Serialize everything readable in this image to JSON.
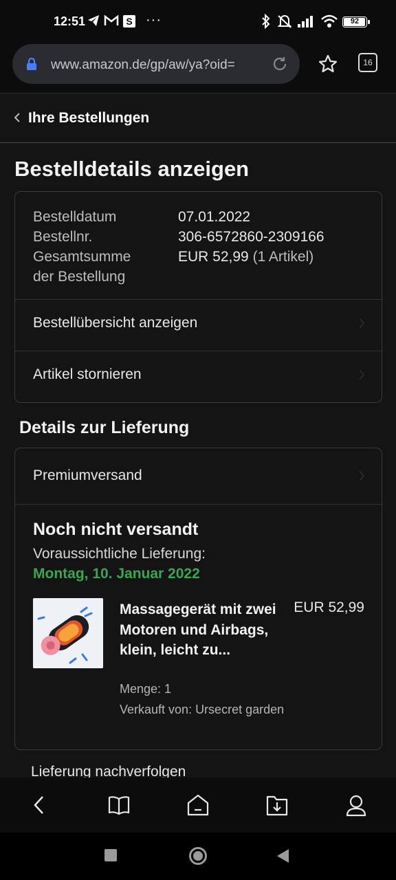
{
  "status_bar": {
    "time": "12:51",
    "sim_letter": "S",
    "more": "···",
    "battery": "92",
    "battery_level": 0.92
  },
  "browser": {
    "url": "www.amazon.de/gp/aw/ya?oid=",
    "tab_count": "16"
  },
  "page": {
    "back_label": "Ihre Bestellungen",
    "title": "Bestelldetails anzeigen",
    "order": {
      "date_label": "Bestelldatum",
      "date_value": "07.01.2022",
      "number_label": "Bestellnr.",
      "number_value": "306-6572860-2309166",
      "total_label_1": "Gesamtsumme",
      "total_label_2": "der Bestellung",
      "total_value": "EUR 52,99",
      "total_items": "(1 Artikel)"
    },
    "summary_link": "Bestellübersicht anzeigen",
    "cancel_link": "Artikel stornieren",
    "delivery_heading": "Details zur Lieferung",
    "shipping_method": "Premiumversand",
    "ship_status": "Noch nicht versandt",
    "eta_label": "Voraussichtliche Lieferung:",
    "eta_date": "Montag, 10. Januar 2022",
    "product": {
      "title": "Massagegerät mit zwei Motoren und Airbags, klein, leicht zu...",
      "price": "EUR 52,99",
      "quantity": "Menge: 1",
      "seller": "Verkauft von: Ursecret garden"
    },
    "track_link": "Lieferung nachverfolgen"
  },
  "colors": {
    "eta_green": "#3aa655",
    "lock_blue": "#4a7dff",
    "background": "#141414"
  },
  "icons": [
    "telegram-icon",
    "gmail-icon",
    "bluetooth-icon",
    "silent-icon",
    "signal-icon",
    "wifi-icon",
    "lock-icon",
    "reload-icon",
    "star-icon",
    "back-icon",
    "book-icon",
    "home-icon",
    "download-icon",
    "profile-icon"
  ]
}
